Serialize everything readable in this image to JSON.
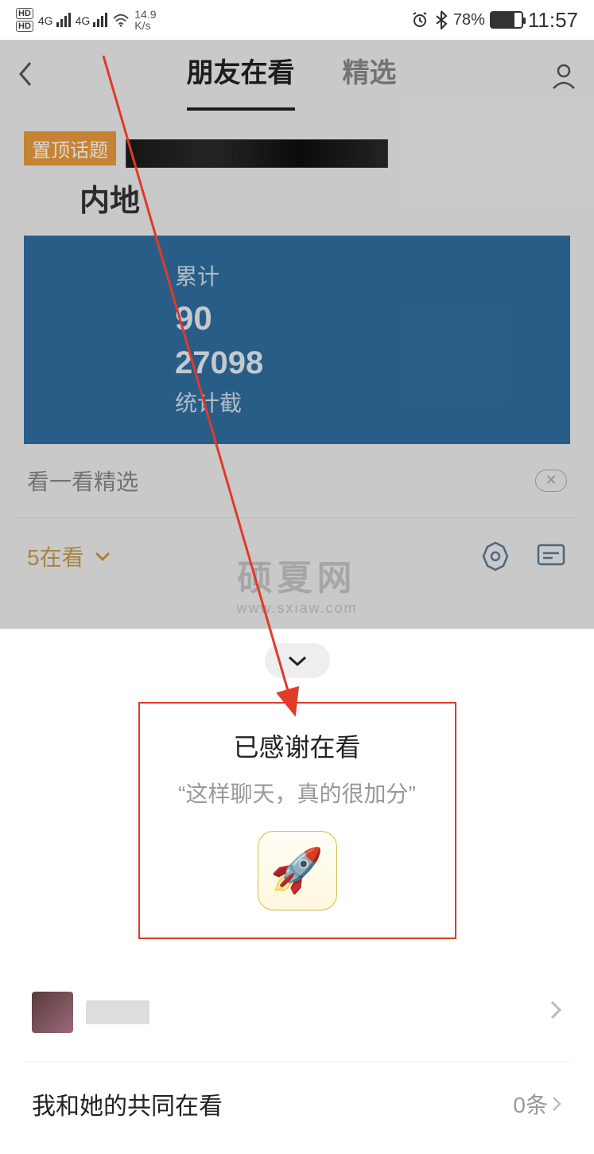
{
  "status": {
    "hd1": "HD",
    "hd2": "HD",
    "net1": "4G",
    "net2": "4G",
    "speed_num": "14.9",
    "speed_unit": "K/s",
    "battery_pct": "78%",
    "time": "11:57"
  },
  "header": {
    "tab_active": "朋友在看",
    "tab_other": "精选"
  },
  "topic": {
    "badge": "置顶话题",
    "title": "内地",
    "stat_label": "累计",
    "stat1": "90",
    "stat2": "27098",
    "stat_footer": "统计截"
  },
  "suggest": {
    "label": "看一看精选"
  },
  "reading": {
    "count_label": "5在看"
  },
  "watermark": {
    "main": "硕夏网",
    "sub": "www.sxiaw.com"
  },
  "sheet": {
    "thanks_title": "已感谢在看",
    "thanks_sub": "“这样聊天，真的很加分”",
    "rocket": "🚀",
    "common_label": "我和她的共同在看",
    "common_count": "0条"
  }
}
